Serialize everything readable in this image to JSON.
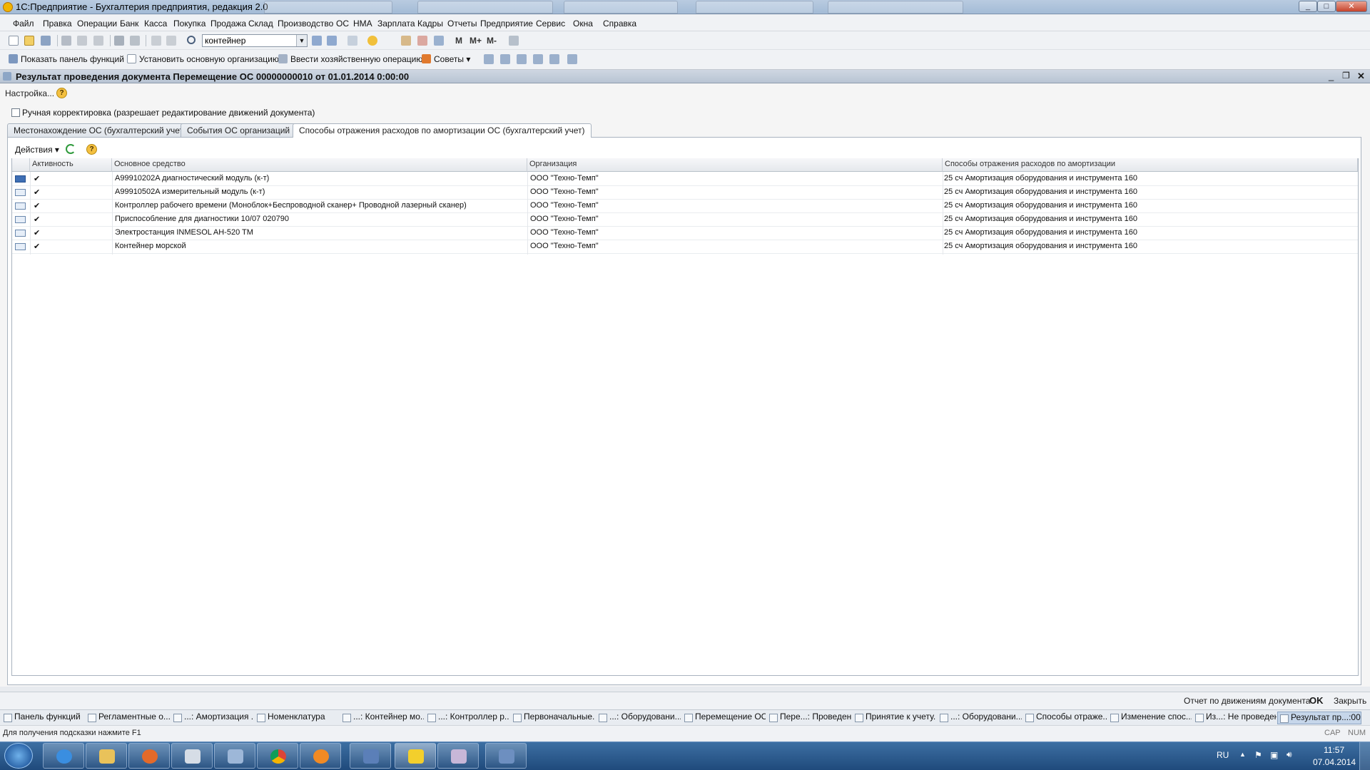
{
  "window": {
    "title": "1С:Предприятие - Бухгалтерия предприятия, редакция 2.0",
    "minimize": "_",
    "maximize": "□",
    "close": "✕"
  },
  "menu": [
    "Файл",
    "Правка",
    "Операции",
    "Банк",
    "Касса",
    "Покупка",
    "Продажа",
    "Склад",
    "Производство",
    "ОС",
    "НМА",
    "Зарплата",
    "Кадры",
    "Отчеты",
    "Предприятие",
    "Сервис",
    "Окна",
    "Справка"
  ],
  "toolbar": {
    "search_value": "контейнер",
    "m": "М",
    "m_plus": "М+",
    "m_minus": "М-"
  },
  "toolbar2": {
    "show_panel": "Показать панель функций",
    "set_org": "Установить основную организацию",
    "enter_op": "Ввести хозяйственную операцию",
    "tips": "Советы"
  },
  "doc": {
    "title": "Результат проведения документа Перемещение ОС 00000000010 от 01.01.2014 0:00:00",
    "settings": "Настройка...",
    "manual_label": "Ручная корректировка (разрешает редактирование движений документа)",
    "tabs": [
      "Местонахождение ОС (бухгалтерский учет)",
      "События ОС организаций",
      "Способы отражения расходов по амортизации ОС (бухгалтерский учет)"
    ],
    "actions": "Действия",
    "columns": [
      "Активность",
      "Основное средство",
      "Организация",
      "Способы отражения расходов по амортизации"
    ],
    "rows": [
      {
        "active": "✔",
        "asset": "A99910202A диагностический модуль (к-т)",
        "org": "ООО \"Техно-Темп\"",
        "method": "25 сч  Амортизация оборудования и инструмента 160"
      },
      {
        "active": "✔",
        "asset": "A99910502A измерительный модуль (к-т)",
        "org": "ООО \"Техно-Темп\"",
        "method": "25 сч  Амортизация оборудования и инструмента 160"
      },
      {
        "active": "✔",
        "asset": "Контроллер рабочего времени (Моноблок+Беспроводной сканер+ Проводной лазерный сканер)",
        "org": "ООО \"Техно-Темп\"",
        "method": "25 сч  Амортизация оборудования и инструмента 160"
      },
      {
        "active": "✔",
        "asset": "Приспособление для диагностики 10/07 020790",
        "org": "ООО \"Техно-Темп\"",
        "method": "25 сч  Амортизация оборудования и инструмента 160"
      },
      {
        "active": "✔",
        "asset": "Электростанция INMESOL AH-520 TM",
        "org": "ООО \"Техно-Темп\"",
        "method": "25 сч  Амортизация оборудования и инструмента 160"
      },
      {
        "active": "✔",
        "asset": "Контейнер морской",
        "org": "ООО \"Техно-Темп\"",
        "method": "25 сч  Амортизация оборудования и инструмента 160"
      }
    ],
    "report_link": "Отчет по движениям документа",
    "ok": "OK",
    "close": "Закрыть"
  },
  "window_tabs": [
    "Панель функций",
    "Регламентные о...",
    "...: Амортизация ...",
    "Номенклатура",
    "...: Контейнер мо...",
    "...: Контроллер р...",
    "Первоначальные...",
    "...: Оборудовани...",
    "Перемещение ОС",
    "Пере...: Проведен",
    "Принятие к учету...",
    "...: Оборудовани...",
    "Способы отраже...",
    "Изменение спос...",
    "Из...: Не проведен",
    "Результат пр...:00"
  ],
  "status": {
    "hint": "Для получения подсказки нажмите F1",
    "cap": "CAP",
    "num": "NUM"
  },
  "taskbar": {
    "lang": "RU",
    "time": "11:57",
    "date": "07.04.2014"
  }
}
